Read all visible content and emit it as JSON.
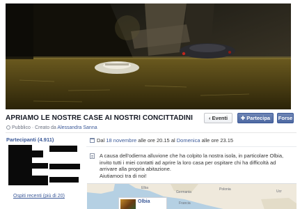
{
  "event": {
    "title": "APRIAMO LE NOSTRE CASE AI NOSTRI CONCITTADINI",
    "privacy": "Pubblico",
    "created_by_prefix": "· Creato da",
    "creator": "Alessandra Sanna"
  },
  "actions": {
    "events_label": "Eventi",
    "join_label": "Partecipa",
    "more_label": "Forse"
  },
  "participants": {
    "title": "Partecipanti (4.911)",
    "recent_link": "Ospiti recenti (più di 20)"
  },
  "schedule": {
    "day_prefix": "Dal",
    "start_date": "18 novembre",
    "start_time_prefix": "alle ore",
    "start_time": "20.15",
    "to_prefix": "al",
    "end_day": "Domenica",
    "end_time_prefix": "alle ore",
    "end_time": "23.15"
  },
  "description": {
    "text": "A causa dell'odierna alluvione che ha colpito la nostra isola, in particolare Olbia, invito tutti i miei contatti ad aprire la loro casa per ospitare chi ha difficoltà ad arrivare alla propria abitazione.\nAiutiamoci tra di noi!"
  },
  "map": {
    "label_1": "Elba",
    "label_2": "Germania",
    "label_3": "Polonia",
    "label_4": "Ucr",
    "label_5": "Francia",
    "place_name": "Olbia"
  },
  "icons": [
    "globe-icon",
    "calendar-icon",
    "document-icon",
    "events-arrow-icon",
    "add-person-icon"
  ]
}
